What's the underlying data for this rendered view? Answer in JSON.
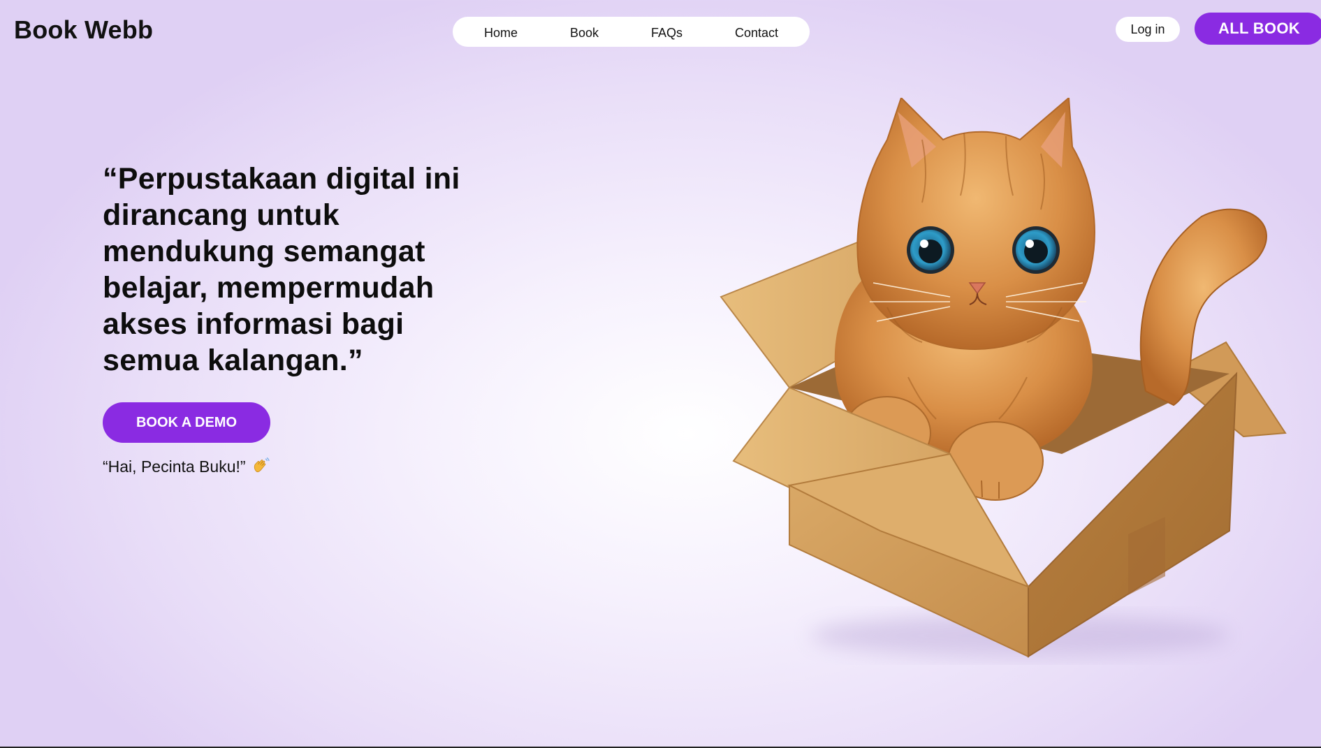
{
  "brand": {
    "name": "Book Webb",
    "accent": "#8a2be2"
  },
  "nav": {
    "items": [
      "Home",
      "Book",
      "FAQs",
      "Contact"
    ]
  },
  "header": {
    "login_label": "Log in",
    "all_book_label": "ALL BOOK"
  },
  "hero": {
    "quote": "“Perpustakaan digital ini dirancang untuk mendukung semangat belajar, mempermudah akses informasi bagi semua kalangan.”",
    "cta_label": "BOOK A DEMO",
    "greeting": "“Hai, Pecinta Buku!”",
    "greeting_icon": "waving-hand-icon",
    "illustration": "cat-in-box-illustration"
  }
}
